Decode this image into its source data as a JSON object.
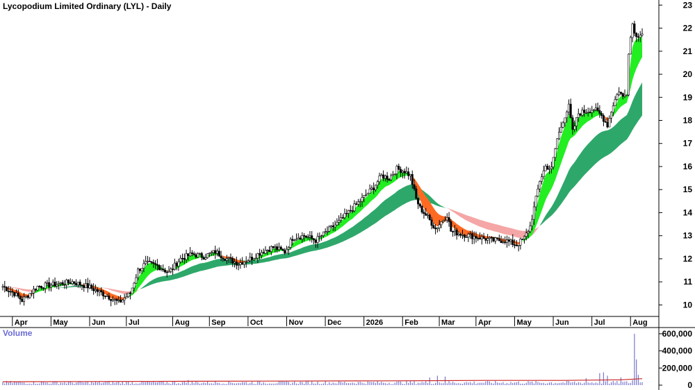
{
  "chart_data": {
    "type": "candlestick",
    "title": "Lycopodium Limited Ordinary (LYL) - Daily",
    "volume_label": "Volume",
    "price_axis": {
      "ticks": [
        10,
        11,
        12,
        13,
        14,
        15,
        16,
        17,
        18,
        19,
        20,
        21,
        22,
        23
      ],
      "range": [
        9.5,
        23.1
      ]
    },
    "volume_axis": {
      "ticks": [
        0,
        200000,
        400000,
        600000
      ],
      "tick_labels": [
        "0",
        "200,000",
        "400,000",
        "600,000"
      ],
      "range": [
        0,
        640000
      ]
    },
    "x_axis": {
      "range": [
        0,
        331
      ],
      "months": [
        {
          "label": "Apr",
          "day": 10
        },
        {
          "label": "May",
          "day": 30
        },
        {
          "label": "Jun",
          "day": 50
        },
        {
          "label": "Jul",
          "day": 69
        },
        {
          "label": "Aug",
          "day": 93
        },
        {
          "label": "Sep",
          "day": 112
        },
        {
          "label": "Oct",
          "day": 132
        },
        {
          "label": "Nov",
          "day": 152
        },
        {
          "label": "Dec",
          "day": 172
        },
        {
          "label": "2026",
          "day": 192
        },
        {
          "label": "Feb",
          "day": 212
        },
        {
          "label": "Mar",
          "day": 231
        },
        {
          "label": "Apr",
          "day": 250
        },
        {
          "label": "May",
          "day": 270
        },
        {
          "label": "Jun",
          "day": 290
        },
        {
          "label": "Jul",
          "day": 310
        },
        {
          "label": "Aug",
          "day": 330
        }
      ]
    },
    "close_path": [
      [
        0,
        10.8
      ],
      [
        6,
        10.5
      ],
      [
        10,
        10.2
      ],
      [
        18,
        10.8
      ],
      [
        28,
        10.9
      ],
      [
        36,
        11.0
      ],
      [
        44,
        10.8
      ],
      [
        54,
        10.4
      ],
      [
        60,
        10.1
      ],
      [
        66,
        10.5
      ],
      [
        70,
        11.5
      ],
      [
        74,
        11.8
      ],
      [
        80,
        11.7
      ],
      [
        86,
        11.4
      ],
      [
        92,
        12.0
      ],
      [
        98,
        12.2
      ],
      [
        104,
        12.1
      ],
      [
        110,
        12.3
      ],
      [
        116,
        12.0
      ],
      [
        122,
        11.8
      ],
      [
        128,
        12.0
      ],
      [
        134,
        12.3
      ],
      [
        140,
        12.5
      ],
      [
        146,
        12.3
      ],
      [
        150,
        12.9
      ],
      [
        156,
        13.0
      ],
      [
        162,
        12.8
      ],
      [
        168,
        13.2
      ],
      [
        174,
        13.6
      ],
      [
        180,
        14.1
      ],
      [
        186,
        14.6
      ],
      [
        192,
        15.1
      ],
      [
        196,
        15.6
      ],
      [
        200,
        15.5
      ],
      [
        204,
        15.9
      ],
      [
        208,
        15.8
      ],
      [
        211,
        15.6
      ],
      [
        214,
        14.6
      ],
      [
        216,
        14.2
      ],
      [
        220,
        13.8
      ],
      [
        224,
        13.3
      ],
      [
        227,
        13.6
      ],
      [
        230,
        13.9
      ],
      [
        232,
        13.2
      ],
      [
        236,
        13.1
      ],
      [
        242,
        13.0
      ],
      [
        248,
        12.9
      ],
      [
        254,
        12.8
      ],
      [
        260,
        12.8
      ],
      [
        266,
        12.6
      ],
      [
        270,
        12.9
      ],
      [
        273,
        13.4
      ],
      [
        275,
        14.2
      ],
      [
        278,
        15.4
      ],
      [
        281,
        16.0
      ],
      [
        284,
        15.9
      ],
      [
        287,
        17.2
      ],
      [
        290,
        18.0
      ],
      [
        293,
        18.6
      ],
      [
        295,
        17.5
      ],
      [
        298,
        18.3
      ],
      [
        302,
        18.4
      ],
      [
        306,
        18.5
      ],
      [
        310,
        18.2
      ],
      [
        313,
        17.8
      ],
      [
        316,
        18.7
      ],
      [
        319,
        19.3
      ],
      [
        321,
        19.0
      ],
      [
        323,
        19.2
      ],
      [
        324,
        21.0
      ],
      [
        326,
        22.2
      ],
      [
        328,
        21.6
      ],
      [
        330,
        21.8
      ]
    ],
    "volume_spikes": [
      {
        "day": 96,
        "value": 60000
      },
      {
        "day": 221,
        "value": 90000
      },
      {
        "day": 225,
        "value": 110000
      },
      {
        "day": 229,
        "value": 100000
      },
      {
        "day": 302,
        "value": 80000
      },
      {
        "day": 309,
        "value": 140000
      },
      {
        "day": 311,
        "value": 150000
      },
      {
        "day": 313,
        "value": 110000
      },
      {
        "day": 320,
        "value": 90000
      },
      {
        "day": 326,
        "value": 60000
      },
      {
        "day": 327,
        "value": 600000
      },
      {
        "day": 328,
        "value": 300000
      },
      {
        "day": 329,
        "value": 120000
      }
    ],
    "volume_avg": [
      [
        0,
        40000
      ],
      [
        100,
        45000
      ],
      [
        200,
        50000
      ],
      [
        250,
        55000
      ],
      [
        290,
        55000
      ],
      [
        320,
        62000
      ],
      [
        331,
        75000
      ]
    ],
    "series": [
      {
        "key": "ma_short",
        "bullish_color": "#22ee22",
        "bearish_color": "#ff6a22"
      },
      {
        "key": "ma_long",
        "bullish_color": "#2ea86a",
        "bearish_color": "#f5a6a6"
      }
    ],
    "candle_color": "#000000",
    "volume_bar_color": "#7777cc",
    "volume_avg_color": "#cc2222",
    "grid": false
  }
}
